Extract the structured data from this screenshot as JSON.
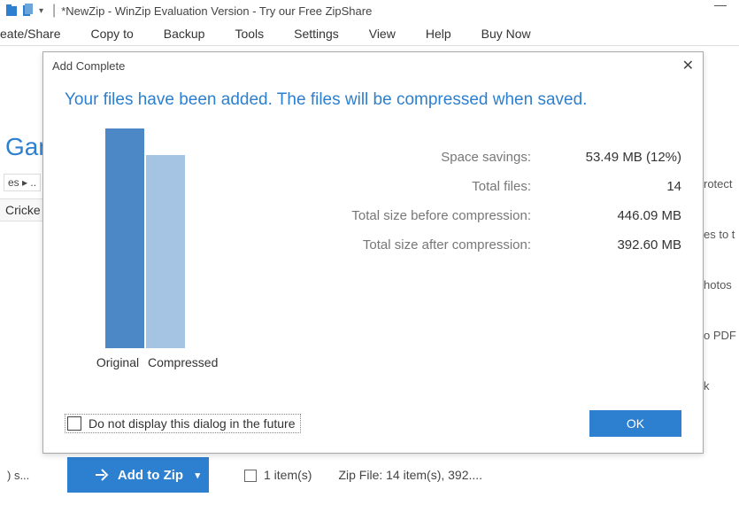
{
  "window": {
    "title": "*NewZip - WinZip Evaluation Version - Try our Free ZipShare"
  },
  "menu": {
    "items": [
      "eate/Share",
      "Copy to",
      "Backup",
      "Tools",
      "Settings",
      "View",
      "Help",
      "Buy Now"
    ]
  },
  "background": {
    "heading_fragment": "Gam",
    "breadcrumb_fragment": "es ▸ ..",
    "list_item_fragment": "Cricke",
    "right_fragments": [
      "rotect",
      "es to t",
      "hotos",
      "o PDF",
      "k"
    ]
  },
  "bottom": {
    "left_fragment": ") s...",
    "add_button": "Add to Zip",
    "status_items": "1 item(s)",
    "zip_status": "Zip File: 14 item(s), 392...."
  },
  "dialog": {
    "title": "Add Complete",
    "message": "Your files have been added.  The files will be compressed when saved.",
    "stats": {
      "space_savings_label": "Space savings:",
      "space_savings_value": "53.49 MB (12%)",
      "total_files_label": "Total files:",
      "total_files_value": "14",
      "before_label": "Total size before compression:",
      "before_value": "446.09 MB",
      "after_label": "Total size after compression:",
      "after_value": "392.60 MB"
    },
    "chart_labels": {
      "original": "Original",
      "compressed": "Compressed"
    },
    "dont_show": "Do not display this dialog in the future",
    "ok": "OK"
  },
  "chart_data": {
    "type": "bar",
    "title": "",
    "categories": [
      "Original",
      "Compressed"
    ],
    "values": [
      446.09,
      392.6
    ],
    "unit": "MB",
    "xlabel": "",
    "ylabel": "",
    "ylim": [
      0,
      446.09
    ]
  },
  "colors": {
    "accent": "#2d7fcf",
    "bar_original": "#4c88c5",
    "bar_compressed": "#a5c4e3"
  }
}
